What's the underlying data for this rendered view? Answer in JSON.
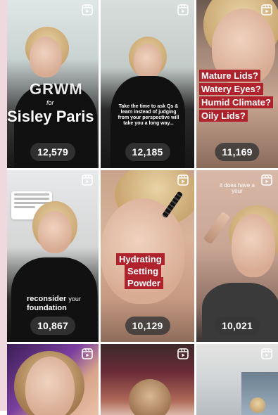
{
  "grid": {
    "tiles": [
      {
        "id": "t1",
        "views": "12,579",
        "overlay": {
          "line1": "GRWM",
          "line2": "for",
          "line3": "Sisley Paris"
        }
      },
      {
        "id": "t2",
        "views": "12,185",
        "overlay": {
          "caption": "Take the time to ask Qs & learn instead of judging from your perspective will take you a long way..."
        }
      },
      {
        "id": "t3",
        "views": "11,169",
        "overlay": {
          "lines": [
            "Mature Lids?",
            "Watery Eyes?",
            "Humid Climate?",
            "Oily Lids?"
          ]
        }
      },
      {
        "id": "t4",
        "views": "10,867",
        "overlay": {
          "line1": "reconsider",
          "line1b": "your",
          "line2": "foundation"
        }
      },
      {
        "id": "t5",
        "views": "10,129",
        "overlay": {
          "lines": [
            "Hydrating",
            "Setting",
            "Powder"
          ]
        }
      },
      {
        "id": "t6",
        "views": "10,021",
        "overlay": {
          "line1": "it does have a",
          "line1b": "",
          "line2": "your",
          "line2b": ""
        }
      },
      {
        "id": "t7",
        "views": ""
      },
      {
        "id": "t8",
        "views": ""
      },
      {
        "id": "t9",
        "views": ""
      }
    ]
  },
  "icons": {
    "reel": "reels-icon"
  },
  "colors": {
    "red_label": "#b1232c",
    "badge_bg": "#373737",
    "side_strip": "#efd9df"
  }
}
